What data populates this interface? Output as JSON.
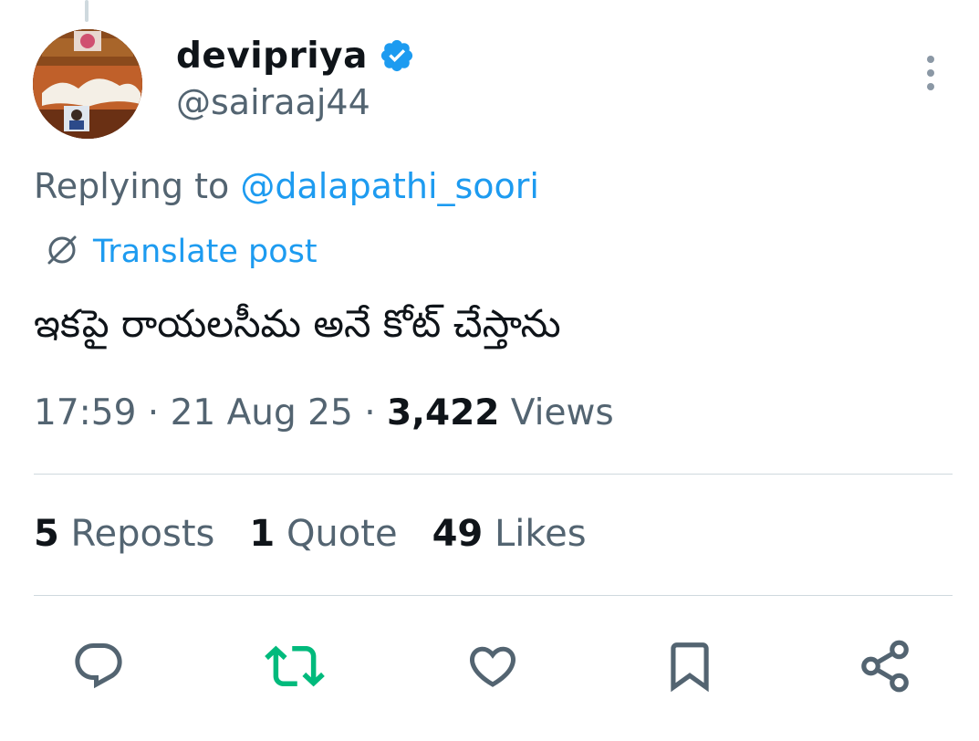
{
  "author": {
    "display_name": "devipriya",
    "handle": "@sairaaj44",
    "verified": true
  },
  "reply": {
    "prefix": "Replying to ",
    "mention": "@dalapathi_soori"
  },
  "translate": {
    "label": "Translate post"
  },
  "post": {
    "text": "ఇకపై రాయలసీమ అనే కోట్ చేస్తాను"
  },
  "meta": {
    "time": "17:59",
    "separator": " · ",
    "date": "21 Aug 25",
    "views_count": "3,422",
    "views_label": " Views"
  },
  "stats": {
    "reposts_count": "5",
    "reposts_label": " Reposts",
    "quotes_count": "1",
    "quotes_label": " Quote",
    "likes_count": "49",
    "likes_label": " Likes"
  },
  "icons": {
    "reply": "reply-icon",
    "repost": "repost-icon",
    "like": "heart-icon",
    "bookmark": "bookmark-icon",
    "share": "share-icon",
    "more": "more-vertical-icon",
    "verified": "verified-badge-icon",
    "translate": "globe-icon"
  },
  "colors": {
    "accent": "#1d9bf0",
    "repost_active": "#00ba7c",
    "text_primary": "#0f1419",
    "text_secondary": "#536471",
    "divider": "#cfd9de"
  }
}
